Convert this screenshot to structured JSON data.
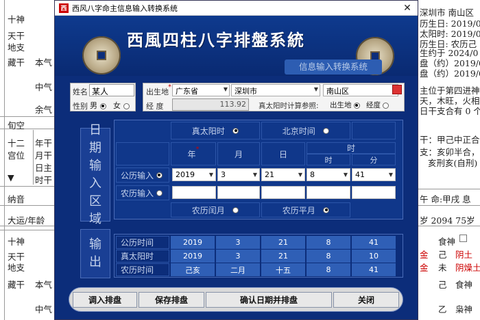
{
  "background": {
    "left_rows": [
      {
        "label": "十神"
      },
      {
        "label": "天干"
      },
      {
        "label": "地支"
      },
      {
        "label": "藏干",
        "sub": "本气"
      },
      {
        "label": "",
        "sub": "中气"
      },
      {
        "label": "",
        "sub": "余气"
      },
      {
        "label": "旬空"
      },
      {
        "label": "十二",
        "sub": "年干"
      },
      {
        "label": "宫位",
        "sub": "月干"
      },
      {
        "label": "",
        "sub": "日主"
      },
      {
        "label": "▼",
        "sub": "时干"
      },
      {
        "label": "纳音"
      },
      {
        "label": "大运/年龄"
      },
      {
        "label": "十神"
      },
      {
        "label": "天干"
      },
      {
        "label": "地支"
      },
      {
        "label": "藏干",
        "sub": "本气"
      },
      {
        "label": "",
        "sub": "中气"
      }
    ],
    "right_lines": [
      "深圳市 南山区",
      "历生日: 2019/0",
      "太阳时: 2019/0",
      "历生日: 农历己",
      "生约于  2024/0",
      "盘（约）2019/0",
      "盘（约）2019/0",
      "主位于第四进神",
      "天，木旺，火相",
      "日干支合有 0 个",
      "干：甲己中正合",
      "支：亥卯半合，",
      "亥刑亥(自刑)",
      "午 命:甲戌 息",
      "岁    2094  75岁"
    ],
    "bottom_right": [
      {
        "a": "食神",
        "b": ""
      },
      {
        "a": "己",
        "b": "阴土"
      },
      {
        "a": "未",
        "b": "阴燥土"
      },
      {
        "a": "己",
        "b": "食神"
      },
      {
        "a": "乙",
        "b": "枭神"
      }
    ]
  },
  "dialog": {
    "window_title": "西风八字命主信息输入转换系统",
    "app_icon_text": "西",
    "close_glyph": "✕",
    "banner_title": "西風四柱八字排盤系統",
    "banner_subtitle": "信息输入转换系统",
    "name_label": "姓名",
    "name_value": "某人",
    "gender_label": "性别",
    "gender_male": "男",
    "gender_female": "女",
    "birthplace_label": "出生地",
    "province": "广东省",
    "city": "深圳市",
    "district": "南山区",
    "longitude_label": "经  度",
    "longitude_value": "113.92",
    "solar_ref_label": "真太阳时计算参照:",
    "solar_ref_birthplace": "出生地",
    "solar_ref_longitude": "经度",
    "date_section_label": [
      "日",
      "期",
      "输",
      "入",
      "区",
      "域"
    ],
    "output_section_label": [
      "输",
      "出"
    ],
    "true_solar_time": "真太阳时",
    "beijing_time": "北京时间",
    "hdr_year": "年",
    "hdr_month": "月",
    "hdr_day": "日",
    "hdr_time": "时",
    "hdr_hour": "时",
    "hdr_minute": "分",
    "gregorian_input": "公历输入",
    "lunar_input": "农历输入",
    "greg_year": "2019",
    "greg_month": "3",
    "greg_day": "21",
    "greg_hour": "8",
    "greg_minute": "41",
    "lunar_leap": "农历闰月",
    "lunar_normal": "农历平月",
    "out_rows": [
      {
        "label": "公历时间",
        "year": "2019",
        "month": "3",
        "day": "21",
        "hour": "8",
        "minute": "41"
      },
      {
        "label": "真太阳时",
        "year": "2019",
        "month": "3",
        "day": "21",
        "hour": "8",
        "minute": "10"
      },
      {
        "label": "农历时间",
        "year": "己亥",
        "month": "二月",
        "day": "十五",
        "hour": "8",
        "minute": "41"
      }
    ],
    "btn_import": "调入排盘",
    "btn_save": "保存排盘",
    "btn_confirm": "确认日期并排盘",
    "btn_close": "关闭",
    "required_mark": "*"
  }
}
